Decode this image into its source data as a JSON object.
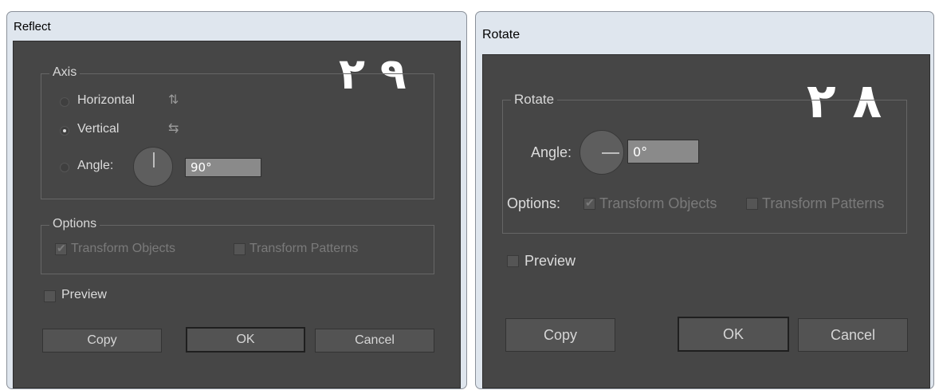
{
  "reflect": {
    "title": "Reflect",
    "overlay_number": "۲ ۹",
    "axis": {
      "legend": "Axis",
      "horizontal_label": "Horizontal",
      "vertical_label": "Vertical",
      "angle_label": "Angle:",
      "angle_value": "90°",
      "selected": "Vertical"
    },
    "options": {
      "legend": "Options",
      "transform_objects": "Transform Objects",
      "transform_patterns": "Transform Patterns"
    },
    "preview_label": "Preview",
    "buttons": {
      "copy": "Copy",
      "ok": "OK",
      "cancel": "Cancel"
    }
  },
  "rotate": {
    "title": "Rotate",
    "overlay_number": "۲ ۸",
    "group_legend": "Rotate",
    "angle_label": "Angle:",
    "angle_value": "0°",
    "options_label": "Options:",
    "transform_objects": "Transform Objects",
    "transform_patterns": "Transform Patterns",
    "preview_label": "Preview",
    "buttons": {
      "copy": "Copy",
      "ok": "OK",
      "cancel": "Cancel"
    }
  },
  "colors": {
    "panel_bg": "#464646",
    "frame_bg": "#dfe6ee",
    "text_light": "#dcdcdc",
    "text_disabled": "#7a7a7a"
  }
}
